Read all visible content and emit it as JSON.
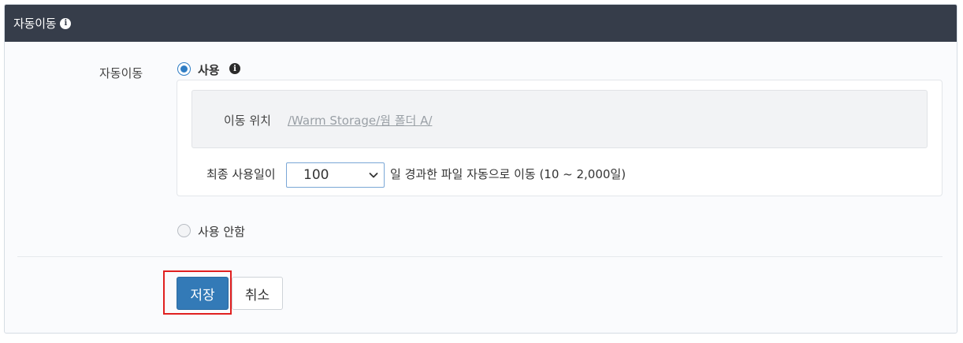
{
  "panel": {
    "title": "자동이동",
    "title_icon": "info-icon"
  },
  "form": {
    "field_label": "자동이동",
    "options": {
      "use_label": "사용",
      "use_selected": true,
      "use_icon": "info-icon",
      "none_label": "사용 안함",
      "none_selected": false
    },
    "location": {
      "label": "이동 위치",
      "path": "/Warm Storage/웜 폴더 A/"
    },
    "days": {
      "prefix": "최종 사용일이",
      "selected_value": "100",
      "suffix": "일 경과한 파일 자동으로 이동 (10 ~ 2,000일)"
    }
  },
  "buttons": {
    "save_label": "저장",
    "cancel_label": "취소"
  },
  "colors": {
    "header_bg": "#363d4a",
    "accent": "#337ab7",
    "highlight": "#e02020"
  }
}
